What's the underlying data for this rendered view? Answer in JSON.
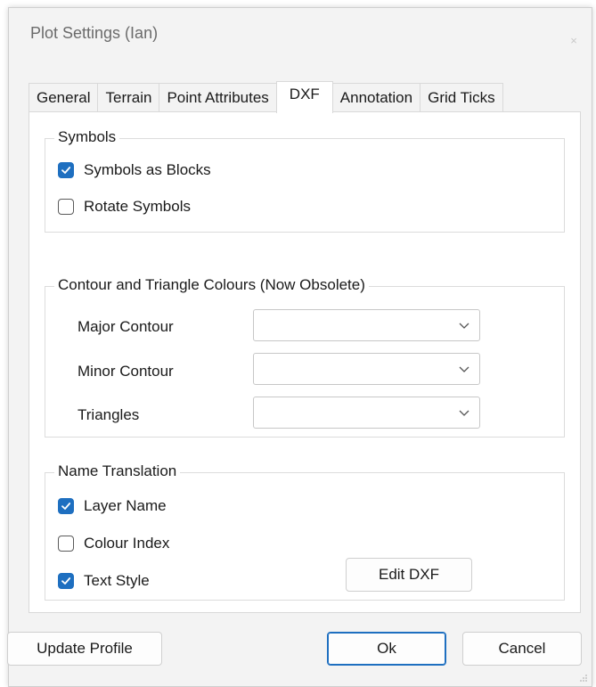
{
  "window": {
    "title": "Plot Settings  (Ian)",
    "close_glyph": "×"
  },
  "tabs": [
    {
      "label": "General",
      "active": false
    },
    {
      "label": "Terrain",
      "active": false
    },
    {
      "label": "Point Attributes",
      "active": false
    },
    {
      "label": "DXF",
      "active": true
    },
    {
      "label": "Annotation",
      "active": false
    },
    {
      "label": "Grid Ticks",
      "active": false
    }
  ],
  "symbols": {
    "legend": "Symbols",
    "symbols_as_blocks": {
      "label": "Symbols as Blocks",
      "checked": true
    },
    "rotate_symbols": {
      "label": "Rotate Symbols",
      "checked": false
    }
  },
  "contour_colours": {
    "legend": "Contour and Triangle Colours (Now Obsolete)",
    "major_contour": {
      "label": "Major Contour",
      "value": ""
    },
    "minor_contour": {
      "label": "Minor Contour",
      "value": ""
    },
    "triangles": {
      "label": "Triangles",
      "value": ""
    }
  },
  "name_translation": {
    "legend": "Name Translation",
    "layer_name": {
      "label": "Layer Name",
      "checked": true
    },
    "colour_index": {
      "label": "Colour Index",
      "checked": false
    },
    "text_style": {
      "label": "Text Style",
      "checked": true
    },
    "edit_dxf_label": "Edit DXF"
  },
  "footer": {
    "update_profile_label": "Update Profile",
    "ok_label": "Ok",
    "cancel_label": "Cancel"
  },
  "colors": {
    "accent": "#1e6fc0",
    "window_bg": "#f3f3f3",
    "page_bg": "#ffffff"
  }
}
